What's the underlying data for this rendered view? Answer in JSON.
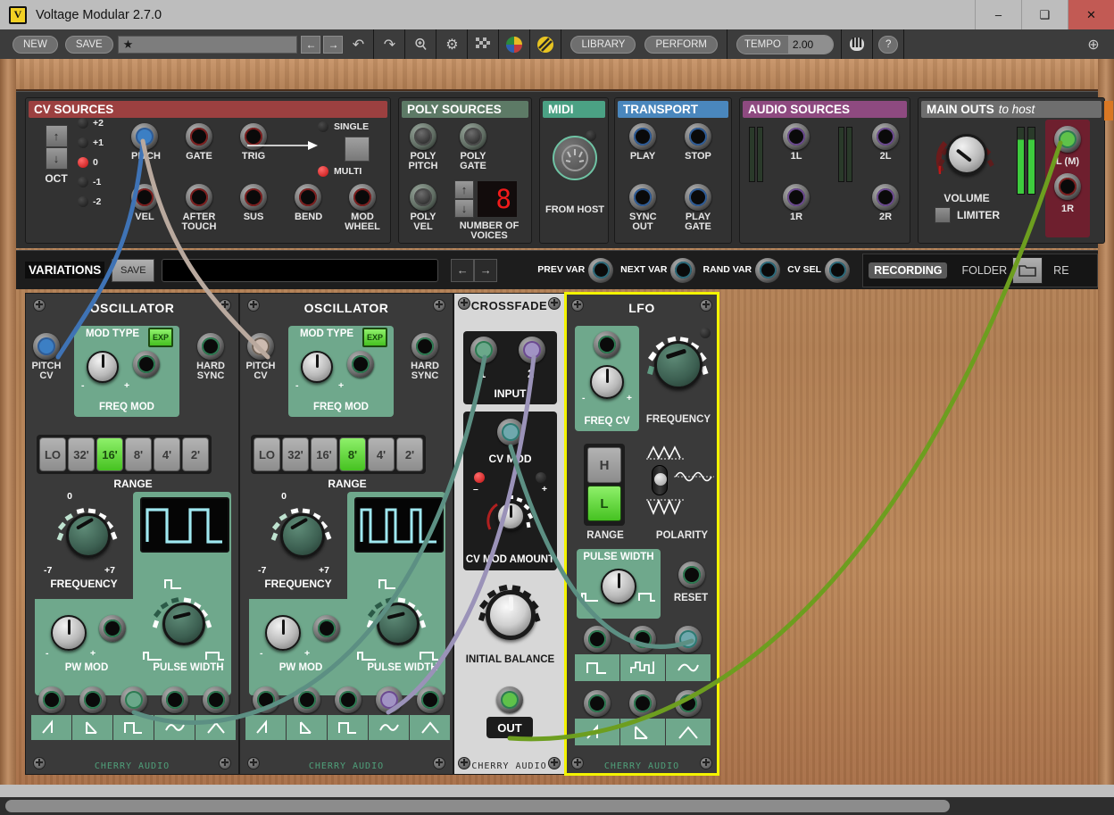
{
  "window": {
    "title": "Voltage Modular 2.7.0",
    "logo_glyph": "V",
    "minimize": "–",
    "maximize": "❑",
    "close": "✕"
  },
  "toolbar": {
    "new_label": "NEW",
    "save_label": "SAVE",
    "preset_star": "★",
    "preset_value": "",
    "prev_label": "←",
    "next_label": "→",
    "undo_label": "↶",
    "redo_label": "↷",
    "zoom_label": "⌕",
    "gear_label": "⚙",
    "grid_label": "▓",
    "palette_label": "●",
    "cable_label": "◐",
    "library_label": "LIBRARY",
    "perform_label": "PERFORM",
    "tempo_label": "TEMPO",
    "tempo_value": "2.00",
    "keyboard_label": "☰",
    "help_label": "?",
    "plus_label": "⊕"
  },
  "io": {
    "cv_sources": {
      "header": "CV SOURCES",
      "header_color": "#9c4040",
      "oct_label": "OCT",
      "oct_up": "↑",
      "oct_down": "↓",
      "oct_values": [
        "+2",
        "+1",
        "0",
        "-1",
        "-2"
      ],
      "oct_selected": "0",
      "jacks_row1": [
        "PITCH",
        "GATE",
        "TRIG"
      ],
      "jacks_row2": [
        "VEL",
        "AFTER TOUCH",
        "SUS",
        "BEND",
        "MOD WHEEL"
      ],
      "single_label": "SINGLE",
      "multi_label": "MULTI",
      "mode_selected": "MULTI"
    },
    "poly_sources": {
      "header": "POLY SOURCES",
      "header_color": "#5d7a66",
      "jacks": [
        "POLY PITCH",
        "POLY GATE",
        "POLY VEL"
      ],
      "voices_label": "NUMBER OF VOICES",
      "voices_value": "8",
      "up": "↑",
      "down": "↓"
    },
    "midi": {
      "header": "MIDI",
      "header_color": "#4ba184",
      "label": "FROM HOST"
    },
    "transport": {
      "header": "TRANSPORT",
      "header_color": "#4a87bd",
      "jacks": [
        "PLAY",
        "STOP",
        "SYNC OUT",
        "PLAY GATE"
      ]
    },
    "audio_sources": {
      "header": "AUDIO SOURCES",
      "header_color": "#8e4a80",
      "jacks": [
        "1L",
        "2L",
        "1R",
        "2R"
      ]
    },
    "main_outs": {
      "header_bold": "MAIN OUTS",
      "header_italic": "to host",
      "header_color": "#6e6e6e",
      "volume_label": "VOLUME",
      "limiter_label": "LIMITER",
      "out_left": "L (M)",
      "out_right": "1R"
    }
  },
  "variations": {
    "label": "VARIATIONS",
    "save_label": "SAVE",
    "name_value": "",
    "prev_arrow": "←",
    "next_arrow": "→",
    "knobs": [
      "PREV VAR",
      "NEXT VAR",
      "RAND VAR",
      "CV SEL"
    ],
    "recording_label": "RECORDING",
    "folder_label": "FOLDER",
    "folder_icon": "☐",
    "rec_label": "RE"
  },
  "modules": [
    {
      "name": "OSCILLATOR",
      "brand": "CHERRY AUDIO",
      "pitch_cv_label": "PITCH CV",
      "mod_type_label": "MOD TYPE",
      "mod_type_button": "EXP",
      "freq_mod_label": "FREQ MOD",
      "minus": "-",
      "plus": "+",
      "hard_sync_label": "HARD SYNC",
      "range_label": "RANGE",
      "range_options": [
        "LO",
        "32'",
        "16'",
        "8'",
        "4'",
        "2'"
      ],
      "range_selected": "16'",
      "freq_label": "FREQUENCY",
      "freq_min": "-7",
      "freq_max": "+7",
      "freq_center": "0",
      "pw_mod_label": "PW MOD",
      "pulse_width_label": "PULSE WIDTH",
      "out_waveforms": [
        "ramp-up",
        "ramp-down",
        "square",
        "sine",
        "triangle"
      ]
    },
    {
      "name": "OSCILLATOR",
      "brand": "CHERRY AUDIO",
      "pitch_cv_label": "PITCH CV",
      "mod_type_label": "MOD TYPE",
      "mod_type_button": "EXP",
      "freq_mod_label": "FREQ MOD",
      "minus": "-",
      "plus": "+",
      "hard_sync_label": "HARD SYNC",
      "range_label": "RANGE",
      "range_options": [
        "LO",
        "32'",
        "16'",
        "8'",
        "4'",
        "2'"
      ],
      "range_selected": "8'",
      "freq_label": "FREQUENCY",
      "freq_min": "-7",
      "freq_max": "+7",
      "freq_center": "0",
      "pw_mod_label": "PW MOD",
      "pulse_width_label": "PULSE WIDTH",
      "out_waveforms": [
        "ramp-up",
        "ramp-down",
        "square",
        "sine",
        "triangle"
      ]
    }
  ],
  "crossfade": {
    "name": "CROSSFADE",
    "brand": "CHERRY AUDIO",
    "input_label": "INPUT",
    "input_1": "1",
    "input_2": "2",
    "cv_mod_label": "CV MOD",
    "cv_mod_amount_label": "CV MOD AMOUNT",
    "minus": "–",
    "plus": "+",
    "initial_balance_label": "INITIAL BALANCE",
    "out_label": "OUT"
  },
  "lfo": {
    "name": "LFO",
    "brand": "CHERRY AUDIO",
    "selected": true,
    "highlight_color": "#f3f300",
    "freq_cv_label": "FREQ CV",
    "minus": "-",
    "plus": "+",
    "frequency_label": "FREQUENCY",
    "range_label": "RANGE",
    "range_options": [
      "H",
      "L"
    ],
    "range_selected": "L",
    "polarity_label": "POLARITY",
    "pulse_width_label": "PULSE WIDTH",
    "reset_label": "RESET",
    "out_row1": [
      "square",
      "stepped-random",
      "sine"
    ],
    "out_row2": [
      "ramp-up",
      "ramp-down",
      "triangle"
    ]
  },
  "cables": [
    {
      "color": "#3f73b5",
      "from": "cv-pitch",
      "to": "osc1-pitch-cv"
    },
    {
      "color": "#b9a99e",
      "from": "cv-pitch",
      "to": "osc2-pitch-cv"
    },
    {
      "color": "#5c8f83",
      "from": "osc1-square-out",
      "to": "crossfade-input-1"
    },
    {
      "color": "#9a92b8",
      "from": "osc2-sine-out",
      "to": "crossfade-input-2"
    },
    {
      "color": "#5c8f83",
      "from": "lfo-sine-out",
      "to": "crossfade-cv-mod"
    },
    {
      "color": "#6d9e1f",
      "from": "crossfade-out",
      "to": "main-out-left"
    }
  ],
  "scrollbar": {
    "orientation": "horizontal"
  }
}
